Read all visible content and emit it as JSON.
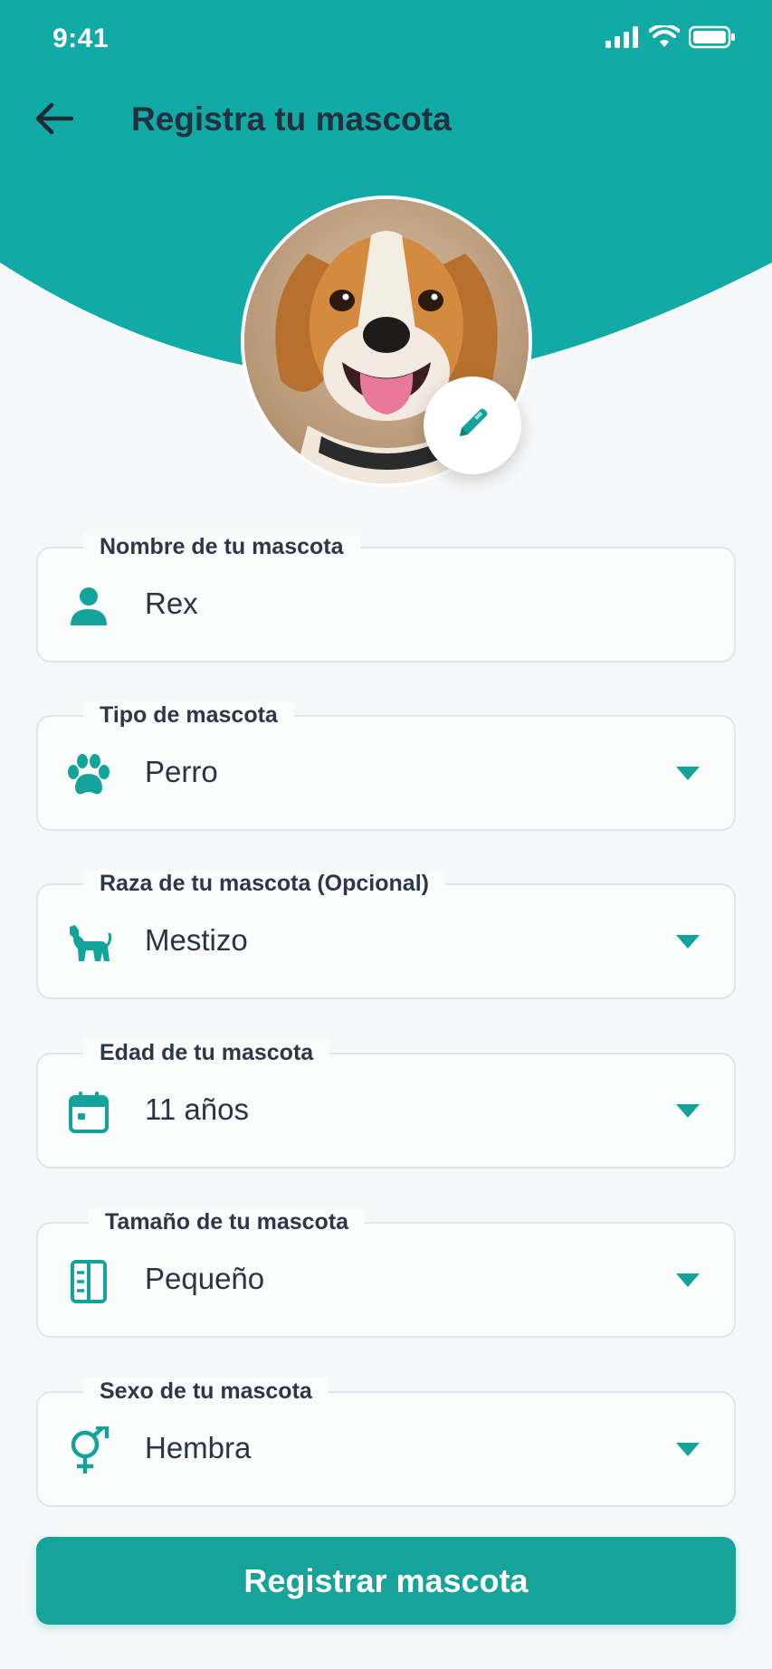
{
  "colors": {
    "accent": "#12aaa4",
    "button": "#16a39a",
    "text": "#2b3445",
    "icon": "#14a39b"
  },
  "status_bar": {
    "time": "9:41"
  },
  "header": {
    "title": "Registra tu mascota"
  },
  "form": {
    "fields": [
      {
        "label": "Nombre de tu mascota",
        "value": "Rex",
        "icon": "person-icon",
        "dropdown": false
      },
      {
        "label": "Tipo de mascota",
        "value": "Perro",
        "icon": "paw-icon",
        "dropdown": true
      },
      {
        "label": "Raza de tu mascota (Opcional)",
        "value": "Mestizo",
        "icon": "dog-icon",
        "dropdown": true
      },
      {
        "label": "Edad de tu mascota",
        "value": "11 años",
        "icon": "calendar-icon",
        "dropdown": true
      },
      {
        "label": "Tamaño de tu mascota",
        "value": "Pequeño",
        "icon": "ruler-icon",
        "dropdown": true
      },
      {
        "label": "Sexo de tu mascota",
        "value": "Hembra",
        "icon": "gender-icon",
        "dropdown": true
      }
    ]
  },
  "submit": {
    "label": "Registrar mascota"
  }
}
